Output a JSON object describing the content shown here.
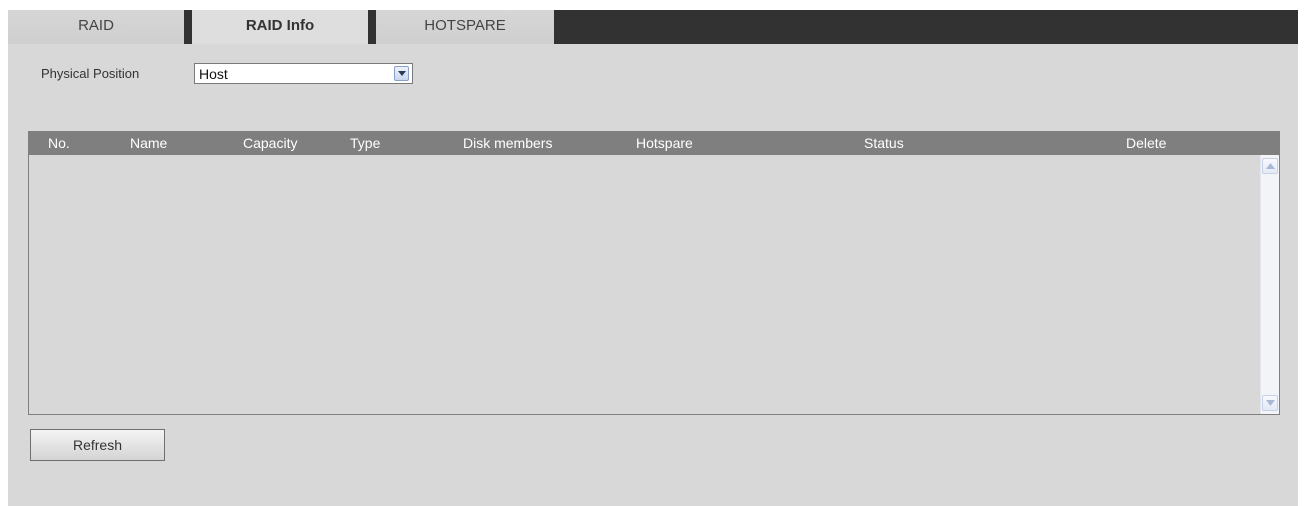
{
  "tabs": [
    {
      "label": "RAID",
      "active": false
    },
    {
      "label": "RAID Info",
      "active": true
    },
    {
      "label": "HOTSPARE",
      "active": false
    }
  ],
  "physical_position": {
    "label": "Physical Position",
    "selected": "Host"
  },
  "table": {
    "columns": [
      "No.",
      "Name",
      "Capacity",
      "Type",
      "Disk members",
      "Hotspare",
      "Status",
      "Delete"
    ],
    "rows": []
  },
  "refresh_label": "Refresh",
  "colors": {
    "background": "#d8d8d8",
    "tabbar": "#323232",
    "table_header": "#7f7f7f",
    "header_text": "#ffffff"
  },
  "icons": {
    "select_arrow": "chevron-down-icon",
    "scroll_up": "scroll-up-icon",
    "scroll_down": "scroll-down-icon"
  }
}
